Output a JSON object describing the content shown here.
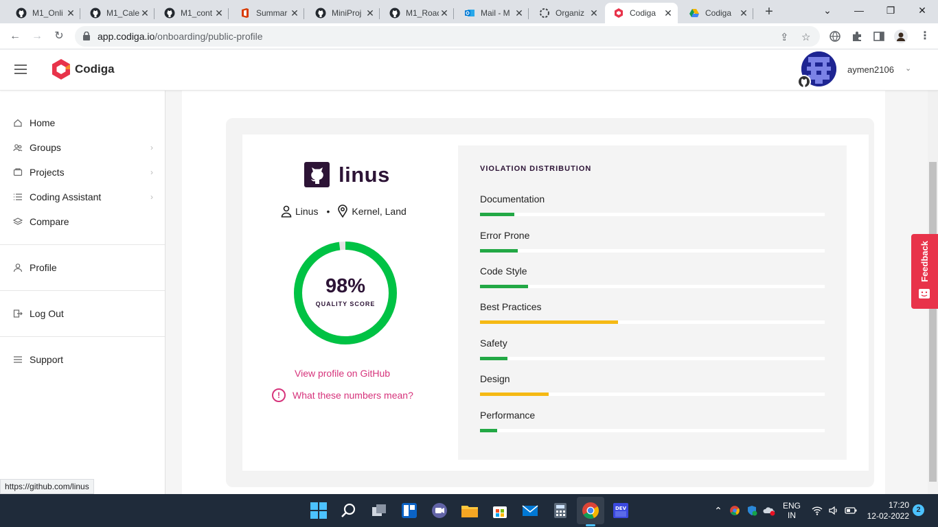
{
  "browser": {
    "tabs": [
      {
        "title": "M1_Onli",
        "icon": "github-icon"
      },
      {
        "title": "M1_Cale",
        "icon": "github-icon"
      },
      {
        "title": "M1_cont",
        "icon": "github-icon"
      },
      {
        "title": "Summar",
        "icon": "office-icon"
      },
      {
        "title": "MiniProj",
        "icon": "github-icon"
      },
      {
        "title": "M1_Road",
        "icon": "github-icon"
      },
      {
        "title": "Mail - M",
        "icon": "outlook-icon"
      },
      {
        "title": "Organiz",
        "icon": "github-org-icon"
      },
      {
        "title": "Codiga",
        "icon": "codiga-icon"
      },
      {
        "title": "Codiga",
        "icon": "codiga-drive-icon"
      }
    ],
    "active_tab": 8,
    "url_host": "app.codiga.io",
    "url_path": "/onboarding/public-profile",
    "status_url": "https://github.com/linus"
  },
  "header": {
    "logo_text": "Codiga",
    "username": "aymen2106"
  },
  "sidebar": {
    "items": [
      {
        "label": "Home",
        "icon": "home-icon",
        "has_children": false
      },
      {
        "label": "Groups",
        "icon": "groups-icon",
        "has_children": true
      },
      {
        "label": "Projects",
        "icon": "projects-icon",
        "has_children": true
      },
      {
        "label": "Coding Assistant",
        "icon": "list-icon",
        "has_children": true
      },
      {
        "label": "Compare",
        "icon": "layers-icon",
        "has_children": false
      },
      {
        "label": "Profile",
        "icon": "user-icon",
        "has_children": false
      },
      {
        "label": "Log Out",
        "icon": "logout-icon",
        "has_children": false
      },
      {
        "label": "Support",
        "icon": "support-icon",
        "has_children": false
      }
    ]
  },
  "profile": {
    "username": "linus",
    "name": "Linus",
    "location": "Kernel, Land",
    "score_text": "98%",
    "score_value": 98,
    "score_label": "QUALITY SCORE",
    "github_link": "View profile on GitHub",
    "help_link": "What these numbers mean?"
  },
  "distribution": {
    "title": "VIOLATION DISTRIBUTION",
    "metrics": [
      {
        "label": "Documentation",
        "value": 10,
        "color": "#22a845"
      },
      {
        "label": "Error Prone",
        "value": 11,
        "color": "#22a845"
      },
      {
        "label": "Code Style",
        "value": 14,
        "color": "#22a845"
      },
      {
        "label": "Best Practices",
        "value": 40,
        "color": "#f5b914"
      },
      {
        "label": "Safety",
        "value": 8,
        "color": "#22a845"
      },
      {
        "label": "Design",
        "value": 20,
        "color": "#f5b914"
      },
      {
        "label": "Performance",
        "value": 5,
        "color": "#22a845"
      }
    ]
  },
  "feedback_label": "Feedback",
  "taskbar": {
    "lang": "ENG",
    "region": "IN",
    "time": "17:20",
    "date": "12-02-2022",
    "notifications": "2"
  },
  "colors": {
    "accent": "#d6337b",
    "score_ring": "#00c244",
    "brand": "#2d1436",
    "feedback": "#e8334a"
  }
}
